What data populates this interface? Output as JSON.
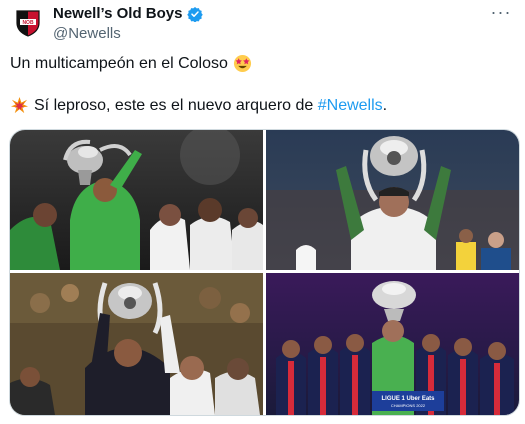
{
  "author": {
    "display_name": "Newell’s Old Boys",
    "handle": "@Newells",
    "avatar_icon": "nob-crest-icon",
    "verified_icon": "verified-badge-icon",
    "verified_color": "#1d9bf0"
  },
  "tweet": {
    "line1": "Un multicampeón en el Coloso",
    "line1_emoji": "star-struck-emoji",
    "line2_emoji": "collision-emoji",
    "line2_prefix": "Sí leproso, este es el nuevo arquero de ",
    "line2_hashtag": "#Newells",
    "line2_suffix": "."
  },
  "media": {
    "photos": [
      {
        "subject": "goalkeeper-lifting-trophy-green-kit"
      },
      {
        "subject": "goalkeeper-holding-trophy-overhead"
      },
      {
        "subject": "player-lifting-trophy-black-jacket"
      },
      {
        "subject": "psg-team-celebrating-trophy"
      }
    ],
    "banner_text": "LIGUE 1 Uber Eats",
    "banner_subtext": "CHAMPIONS 2022"
  },
  "colors": {
    "text": "#0f1419",
    "secondary": "#536471",
    "link": "#1d9bf0",
    "border": "#cfd9de"
  }
}
